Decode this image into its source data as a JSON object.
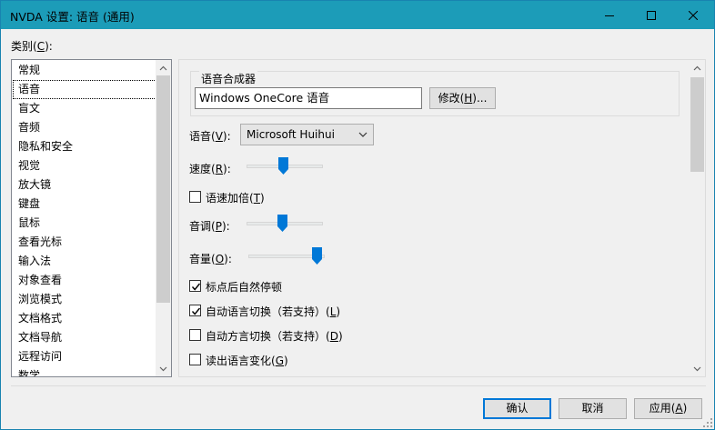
{
  "window": {
    "title": "NVDA 设置: 语音 (通用)",
    "controls": {
      "minimize": "minimize-icon",
      "maximize": "maximize-icon",
      "close": "close-icon"
    }
  },
  "categories": {
    "label_pre": "类别(",
    "label_key": "C",
    "label_post": "):",
    "items": [
      "常规",
      "语音",
      "盲文",
      "音频",
      "隐私和安全",
      "视觉",
      "放大镜",
      "键盘",
      "鼠标",
      "查看光标",
      "输入法",
      "对象查看",
      "浏览模式",
      "文档格式",
      "文档导航",
      "远程访问",
      "数学"
    ],
    "selected_index": 1
  },
  "speech": {
    "synth_group_title": "语音合成器",
    "synth_value": "Windows OneCore 语音",
    "modify_pre": "修改(",
    "modify_key": "H",
    "modify_post": ")...",
    "voice_pre": "语音(",
    "voice_key": "V",
    "voice_post": "):",
    "voice_value": "Microsoft Huihui",
    "rate_pre": "速度(",
    "rate_key": "R",
    "rate_post": "):",
    "rate_level": 0.48,
    "rate_boost_pre": "语速加倍(",
    "rate_boost_key": "T",
    "rate_boost_post": ")",
    "rate_boost_checked": false,
    "pitch_pre": "音调(",
    "pitch_key": "P",
    "pitch_post": "):",
    "pitch_level": 0.47,
    "volume_pre": "音量(",
    "volume_key": "O",
    "volume_post": "):",
    "volume_level": 0.96,
    "punct_pause_label": "标点后自然停顿",
    "punct_pause_checked": true,
    "auto_lang_pre": "自动语言切换（若支持）(",
    "auto_lang_key": "L",
    "auto_lang_post": ")",
    "auto_lang_checked": true,
    "auto_dialect_pre": "自动方言切换（若支持）(",
    "auto_dialect_key": "D",
    "auto_dialect_post": ")",
    "auto_dialect_checked": false,
    "report_lang_pre": "读出语言变化(",
    "report_lang_key": "G",
    "report_lang_post": ")",
    "report_lang_checked": false
  },
  "footer": {
    "ok": "确认",
    "cancel": "取消",
    "apply_pre": "应用(",
    "apply_key": "A",
    "apply_post": ")"
  },
  "colors": {
    "titlebar": "#1c9cb8",
    "accent": "#0078d7",
    "slider_thumb": "#0078d7"
  }
}
